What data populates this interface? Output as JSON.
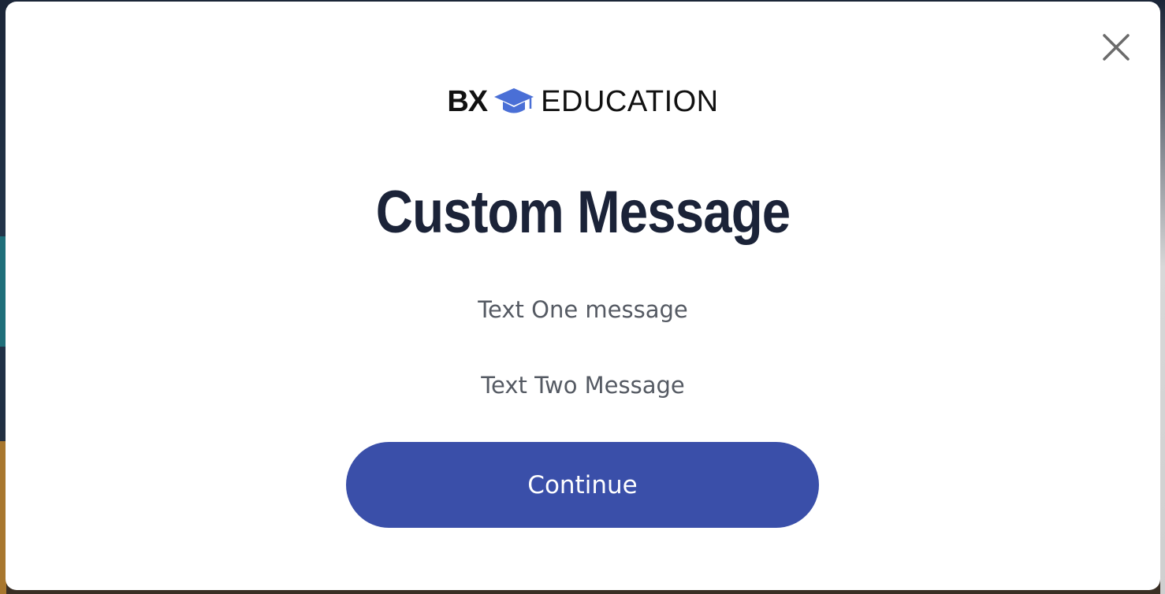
{
  "brand": {
    "mark": "BX",
    "name": "EDUCATION",
    "icon": "graduation-cap-icon",
    "icon_color": "#4a6fd6"
  },
  "modal": {
    "title": "Custom Message",
    "text_one": "Text One message",
    "text_two": "Text Two Message",
    "button_label": "Continue",
    "close_icon": "close-icon"
  },
  "colors": {
    "title": "#1b2338",
    "body_text": "#555a63",
    "button_bg": "#3a4fa9",
    "button_text": "#ffffff"
  }
}
